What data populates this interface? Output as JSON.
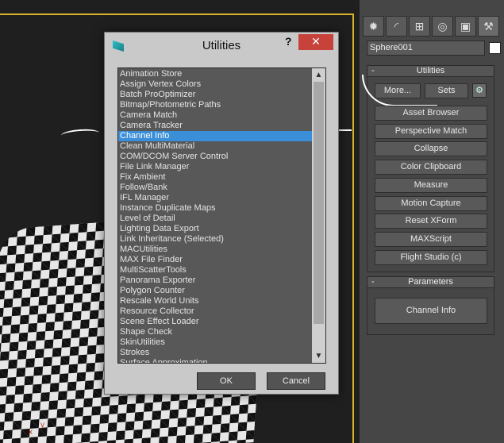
{
  "dialog": {
    "title": "Utilities",
    "help": "?",
    "close": "✕",
    "ok_label": "OK",
    "cancel_label": "Cancel",
    "selected_index": 6,
    "items": [
      "Animation Store",
      "Assign Vertex Colors",
      "Batch ProOptimizer",
      "Bitmap/Photometric Paths",
      "Camera Match",
      "Camera Tracker",
      "Channel Info",
      "Clean MultiMaterial",
      "COM/DCOM Server Control",
      "File Link Manager",
      "Fix Ambient",
      "Follow/Bank",
      "IFL Manager",
      "Instance Duplicate Maps",
      "Level of Detail",
      "Lighting Data Export",
      "Link Inheritance (Selected)",
      "MACUtilities",
      "MAX File Finder",
      "MultiScatterTools",
      "Panorama Exporter",
      "Polygon Counter",
      "Rescale World Units",
      "Resource Collector",
      "Scene Effect Loader",
      "Shape Check",
      "SkinUtilities",
      "Strokes",
      "Surface Approximation"
    ],
    "scroll_up": "▲",
    "scroll_down": "▼"
  },
  "viewport": {
    "axis_y": "y",
    "axis_x": "x"
  },
  "panel": {
    "tabs": [
      {
        "icon": "create-icon",
        "glyph": "✹"
      },
      {
        "icon": "modify-icon",
        "glyph": "◜"
      },
      {
        "icon": "hierarchy-icon",
        "glyph": "⊞"
      },
      {
        "icon": "motion-icon",
        "glyph": "◎"
      },
      {
        "icon": "display-icon",
        "glyph": "▣"
      },
      {
        "icon": "utilities-icon",
        "glyph": "⚒"
      }
    ],
    "object_name": "Sphere001",
    "utilities_header": "Utilities",
    "collapse_symbol": "-",
    "more_label": "More...",
    "sets_label": "Sets",
    "buttons": [
      "Asset Browser",
      "Perspective Match",
      "Collapse",
      "Color Clipboard",
      "Measure",
      "Motion Capture",
      "Reset XForm",
      "MAXScript",
      "Flight Studio (c)"
    ],
    "parameters_header": "Parameters",
    "channel_info_label": "Channel Info",
    "accent_color": "#3b8fd8"
  }
}
